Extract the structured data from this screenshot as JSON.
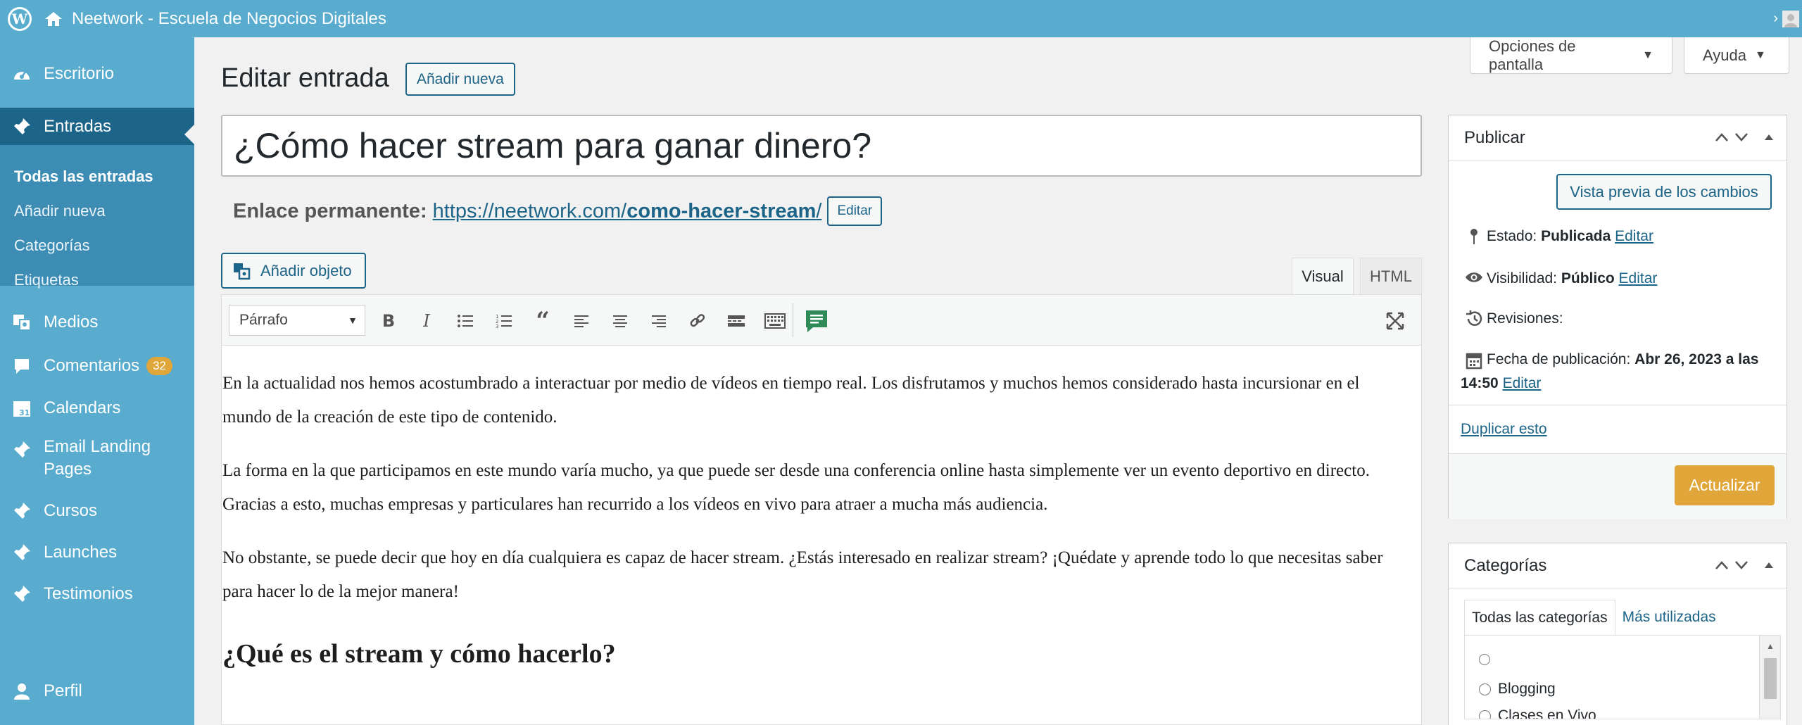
{
  "adminbar": {
    "site_name": "Neetwork - Escuela de Negocios Digitales"
  },
  "sidebar": {
    "items": [
      {
        "label": "Escritorio",
        "icon": "dashboard-icon"
      },
      {
        "label": "Entradas",
        "icon": "pin-icon"
      },
      {
        "label": "Medios",
        "icon": "media-icon"
      },
      {
        "label": "Comentarios",
        "icon": "comments-icon",
        "badge": "32"
      },
      {
        "label": "Calendars",
        "icon": "calendar-icon"
      },
      {
        "label": "Email Landing Pages",
        "line1": "Email Landing",
        "line2": "Pages",
        "icon": "pin-icon"
      },
      {
        "label": "Cursos",
        "icon": "pin-icon"
      },
      {
        "label": "Launches",
        "icon": "pin-icon"
      },
      {
        "label": "Testimonios",
        "icon": "pin-icon"
      },
      {
        "label": "Perfil",
        "icon": "user-icon"
      }
    ],
    "submenu": [
      "Todas las entradas",
      "Añadir nueva",
      "Categorías",
      "Etiquetas"
    ]
  },
  "header": {
    "screen_options": "Opciones de pantalla",
    "help": "Ayuda",
    "title": "Editar entrada",
    "add_new": "Añadir nueva"
  },
  "post": {
    "title": "¿Cómo hacer stream para ganar dinero?",
    "permalink_label": "Enlace permanente:",
    "permalink_base": "https://neetwork.com/",
    "permalink_slug": "como-hacer-stream",
    "permalink_end": "/",
    "edit_label": "Editar"
  },
  "editor": {
    "add_media": "Añadir objeto",
    "tab_visual": "Visual",
    "tab_html": "HTML",
    "format": "Párrafo",
    "paragraphs": [
      "En la actualidad nos hemos acostumbrado a interactuar por medio de vídeos en tiempo real. Los disfrutamos y muchos hemos considerado hasta incursionar en el mundo de la creación de este tipo de contenido.",
      "La forma en la que participamos en este mundo varía mucho, ya que puede ser desde una conferencia online hasta simplemente ver un evento deportivo en directo. Gracias a esto, muchas empresas y particulares han recurrido a los vídeos en vivo para atraer a mucha más audiencia.",
      "No obstante, se puede decir que hoy en día cualquiera es capaz de hacer stream. ¿Estás interesado en realizar stream? ¡Quédate y aprende todo lo que necesitas saber para hacer lo de la mejor manera!"
    ],
    "heading": "¿Qué es el stream y cómo hacerlo?"
  },
  "publish": {
    "title": "Publicar",
    "preview": "Vista previa de los cambios",
    "status_label": "Estado:",
    "status_value": "Publicada",
    "visibility_label": "Visibilidad:",
    "visibility_value": "Público",
    "revisions": "Revisiones:",
    "date_label": "Fecha de publicación:",
    "date_value_1": "Abr 26, 2023 a las",
    "date_value_2": "14:50",
    "edit": "Editar",
    "duplicate": "Duplicar esto",
    "update": "Actualizar"
  },
  "categories": {
    "title": "Categorías",
    "tab_all": "Todas las categorías",
    "tab_most": "Más utilizadas",
    "items": [
      "",
      "Blogging",
      "Clases en Vivo"
    ]
  },
  "colors": {
    "admin_blue": "#5aacce",
    "active_blue": "#1c6488",
    "accent": "#e0a63a"
  }
}
